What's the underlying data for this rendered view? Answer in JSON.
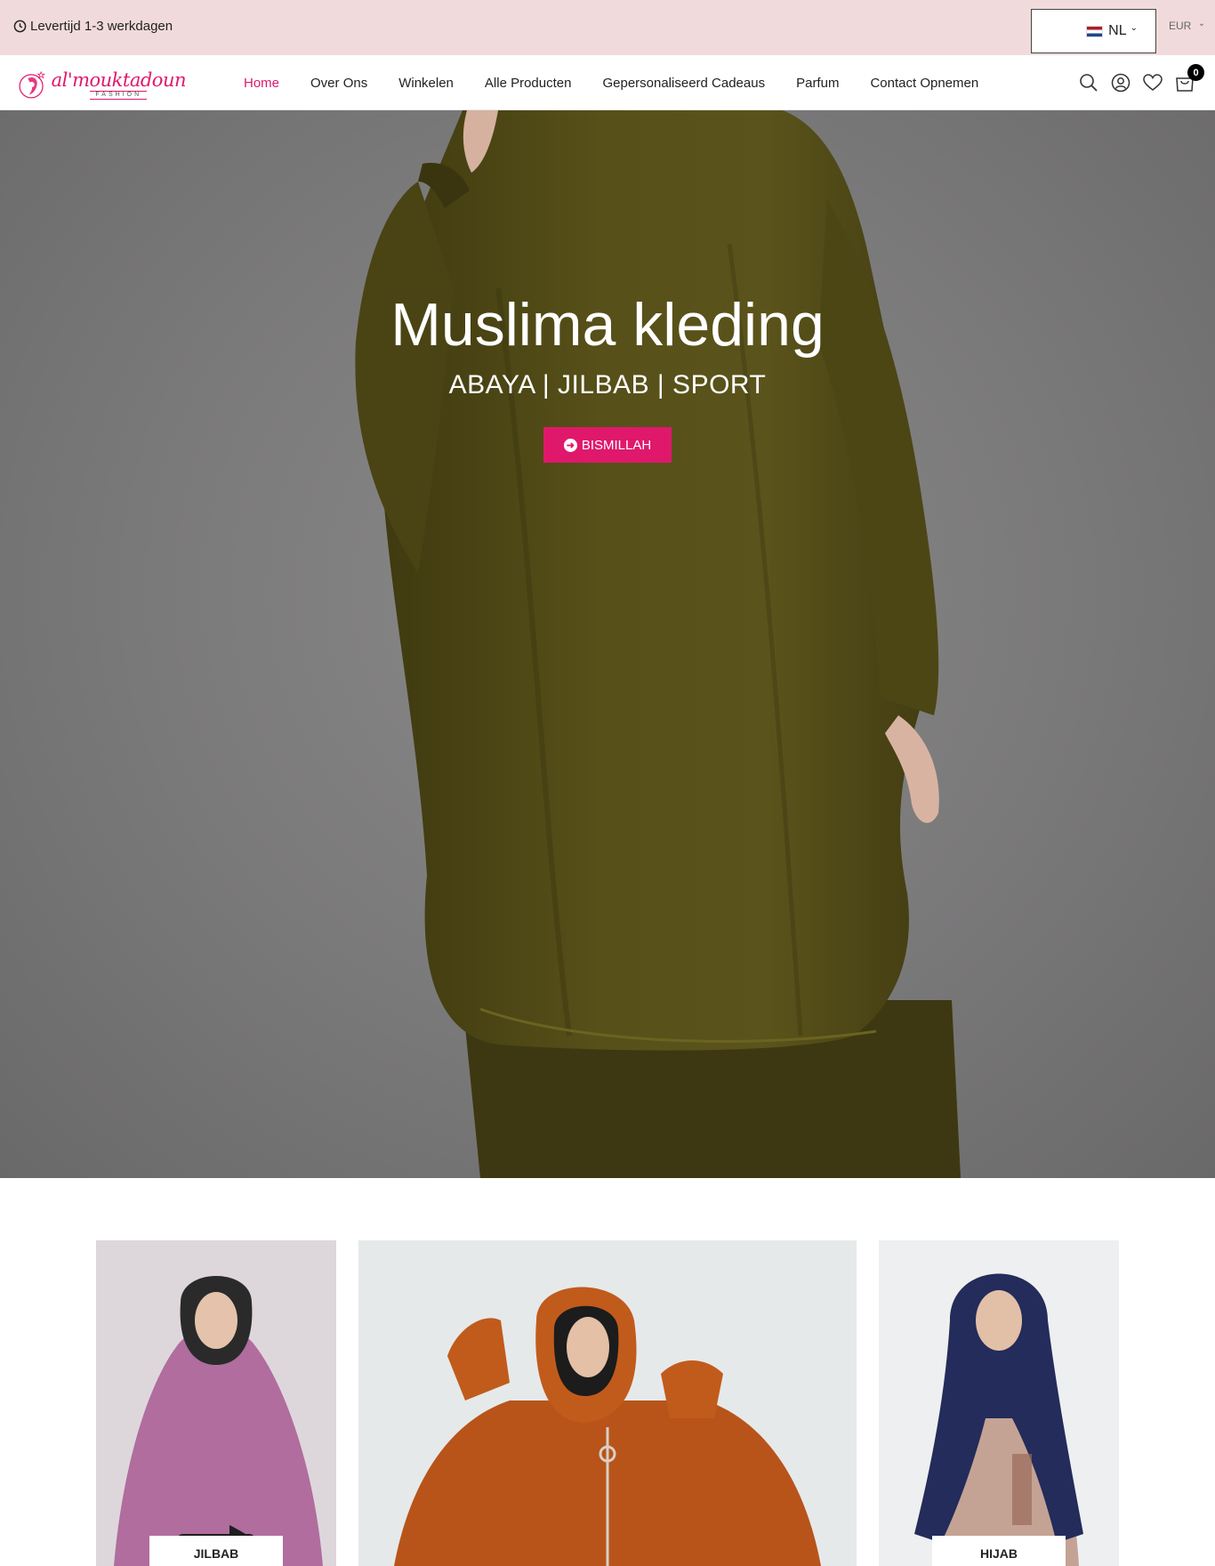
{
  "topbar": {
    "delivery_text": "Levertijd 1-3 werkdagen",
    "language": "NL",
    "currency": "EUR"
  },
  "brand": {
    "name": "al'mouktadoun",
    "tagline": "FASHION",
    "accent_color": "#e0186c"
  },
  "nav": {
    "items": [
      {
        "label": "Home",
        "active": true
      },
      {
        "label": "Over Ons"
      },
      {
        "label": "Winkelen"
      },
      {
        "label": "Alle Producten"
      },
      {
        "label": "Gepersonaliseerd Cadeaus"
      },
      {
        "label": "Parfum"
      },
      {
        "label": "Contact Opnemen"
      }
    ],
    "icons": [
      "search-icon",
      "user-icon",
      "heart-icon",
      "cart-icon"
    ],
    "cart_count": "0"
  },
  "hero": {
    "title": "Muslima kleding",
    "subtitle": "ABAYA | JILBAB | SPORT",
    "button_label": "BISMILLAH"
  },
  "categories": [
    {
      "label": "JILBAB"
    },
    {
      "label": ""
    },
    {
      "label": "HIJAB"
    }
  ]
}
